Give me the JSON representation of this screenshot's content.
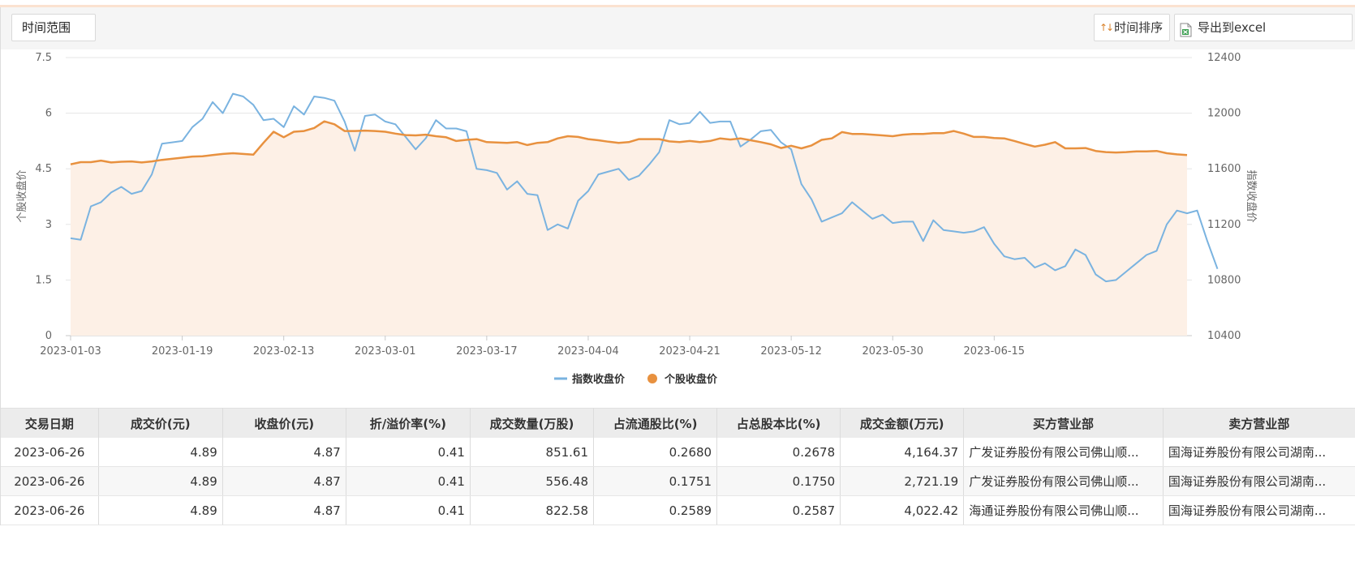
{
  "toolbar": {
    "range_label": "时间范围",
    "sort_label": "时间排序",
    "sort_icon": "sort-arrows-icon",
    "export_label": "导出到excel",
    "export_icon": "excel-icon"
  },
  "colors": {
    "index_line": "#7ab3e0",
    "stock_line": "#e8913f",
    "area_fill": "#fdf0e6",
    "grid": "#e6e6e6",
    "accent_top": "#fbe2d0"
  },
  "chart_data": {
    "type": "line",
    "dual_axis": true,
    "left_axis": {
      "label": "个股收盘价",
      "ticks": [
        "0",
        "1.5",
        "3",
        "4.5",
        "6",
        "7.5"
      ],
      "range": [
        0,
        7.5
      ]
    },
    "right_axis": {
      "label": "指数收盘价",
      "ticks": [
        "10400",
        "10800",
        "11200",
        "11600",
        "12000",
        "12400"
      ],
      "range": [
        10400,
        12400
      ]
    },
    "x_ticks": [
      "2023-01-03",
      "2023-01-19",
      "2023-02-13",
      "2023-03-01",
      "2023-03-17",
      "2023-04-04",
      "2023-04-21",
      "2023-05-12",
      "2023-05-30",
      "2023-06-15"
    ],
    "x_tick_index": [
      0,
      11,
      21,
      31,
      41,
      51,
      61,
      71,
      81,
      91
    ],
    "legend": [
      "指数收盘价",
      "个股收盘价"
    ],
    "legend_position": "bottom",
    "grid": true,
    "series": [
      {
        "name": "指数收盘价",
        "axis": "right",
        "color": "#7ab3e0",
        "values": [
          11100,
          11090,
          11330,
          11360,
          11430,
          11470,
          11420,
          11440,
          11560,
          11780,
          11790,
          11800,
          11900,
          11960,
          12080,
          12000,
          12140,
          12120,
          12060,
          11950,
          11960,
          11900,
          12050,
          11990,
          12120,
          12110,
          12090,
          11940,
          11730,
          11980,
          11990,
          11940,
          11920,
          11830,
          11740,
          11820,
          11950,
          11890,
          11890,
          11870,
          11600,
          11590,
          11570,
          11450,
          11510,
          11420,
          11410,
          11160,
          11200,
          11170,
          11370,
          11440,
          11560,
          11580,
          11600,
          11520,
          11550,
          11630,
          11720,
          11950,
          11920,
          11930,
          12010,
          11930,
          11940,
          11940,
          11760,
          11810,
          11870,
          11880,
          11790,
          11740,
          11490,
          11380,
          11220,
          11250,
          11280,
          11360,
          11300,
          11240,
          11270,
          11210,
          11220,
          11220,
          11080,
          11230,
          11160,
          11150,
          11140,
          11150,
          11180,
          11060,
          10970,
          10950,
          10960,
          10890,
          10920,
          10870,
          10900,
          11020,
          10980,
          10840,
          10790,
          10800,
          10860,
          10920,
          10980,
          11010,
          11200,
          11300,
          11280,
          11300,
          11080,
          10880
        ]
      },
      {
        "name": "个股收盘价",
        "axis": "left",
        "color": "#e8913f",
        "values": [
          4.62,
          4.68,
          4.68,
          4.72,
          4.67,
          4.69,
          4.7,
          4.67,
          4.7,
          4.74,
          4.77,
          4.8,
          4.83,
          4.84,
          4.87,
          4.9,
          4.92,
          4.9,
          4.88,
          5.2,
          5.5,
          5.35,
          5.5,
          5.52,
          5.6,
          5.78,
          5.7,
          5.52,
          5.52,
          5.53,
          5.52,
          5.5,
          5.45,
          5.41,
          5.4,
          5.42,
          5.38,
          5.35,
          5.25,
          5.28,
          5.3,
          5.22,
          5.21,
          5.2,
          5.22,
          5.14,
          5.2,
          5.22,
          5.32,
          5.38,
          5.36,
          5.3,
          5.27,
          5.23,
          5.2,
          5.22,
          5.3,
          5.3,
          5.3,
          5.24,
          5.22,
          5.25,
          5.22,
          5.25,
          5.32,
          5.29,
          5.32,
          5.27,
          5.22,
          5.16,
          5.06,
          5.12,
          5.05,
          5.13,
          5.28,
          5.32,
          5.49,
          5.44,
          5.44,
          5.42,
          5.4,
          5.38,
          5.42,
          5.44,
          5.44,
          5.46,
          5.46,
          5.52,
          5.45,
          5.36,
          5.36,
          5.33,
          5.32,
          5.25,
          5.17,
          5.1,
          5.15,
          5.22,
          5.05,
          5.05,
          5.06,
          4.98,
          4.95,
          4.94,
          4.95,
          4.97,
          4.97,
          4.98,
          4.92,
          4.89,
          4.87
        ]
      }
    ]
  },
  "table": {
    "headers": [
      "交易日期",
      "成交价(元)",
      "收盘价(元)",
      "折/溢价率(%)",
      "成交数量(万股)",
      "占流通股比(%)",
      "占总股本比(%)",
      "成交金额(万元)",
      "买方营业部",
      "卖方营业部"
    ],
    "rows": [
      [
        "2023-06-26",
        "4.89",
        "4.87",
        "0.41",
        "851.61",
        "0.2680",
        "0.2678",
        "4,164.37",
        "广发证券股份有限公司佛山顺...",
        "国海证券股份有限公司湖南..."
      ],
      [
        "2023-06-26",
        "4.89",
        "4.87",
        "0.41",
        "556.48",
        "0.1751",
        "0.1750",
        "2,721.19",
        "广发证券股份有限公司佛山顺...",
        "国海证券股份有限公司湖南..."
      ],
      [
        "2023-06-26",
        "4.89",
        "4.87",
        "0.41",
        "822.58",
        "0.2589",
        "0.2587",
        "4,022.42",
        "海通证券股份有限公司佛山顺...",
        "国海证券股份有限公司湖南..."
      ]
    ]
  }
}
